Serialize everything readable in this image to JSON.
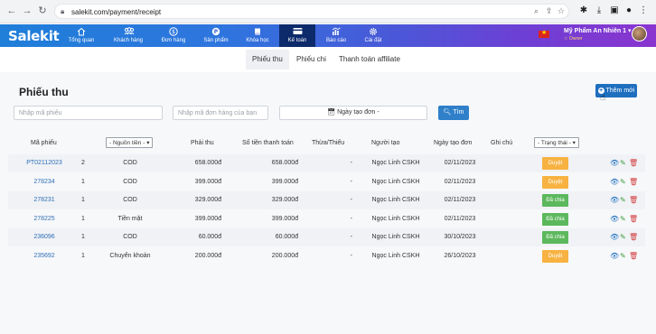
{
  "browser": {
    "url": "salekit.com/payment/receipt"
  },
  "header": {
    "logo": "Salekit",
    "menu": [
      {
        "label": "Tổng quan",
        "icon": "home-icon"
      },
      {
        "label": "Khách hàng",
        "icon": "users-icon"
      },
      {
        "label": "Đơn hàng",
        "icon": "dollar-icon"
      },
      {
        "label": "Sản phẩm",
        "icon": "product-icon"
      },
      {
        "label": "Khóa học",
        "icon": "book-icon"
      },
      {
        "label": "Kế toán",
        "icon": "card-icon"
      },
      {
        "label": "Báo cáo",
        "icon": "chart-icon"
      },
      {
        "label": "Cài đặt",
        "icon": "gear-icon"
      }
    ],
    "active_menu": "Kế toán",
    "user_name": "Mỹ Phẩm An Nhiên 1",
    "user_role": "Owner"
  },
  "subtabs": [
    {
      "label": "Phiếu thu",
      "active": true
    },
    {
      "label": "Phiếu chi",
      "active": false
    },
    {
      "label": "Thanh toán affiliate",
      "active": false
    }
  ],
  "page": {
    "title": "Phiếu thu",
    "add_button": "Thêm mới",
    "filters": {
      "receipt_placeholder": "Nhập mã phiếu",
      "order_placeholder": "Nhập mã đơn hàng của bạn",
      "date_label": "Ngày tạo đơn -",
      "search_label": "Tìm"
    }
  },
  "table": {
    "columns": {
      "code": "Mã phiếu",
      "source": "- Nguồn tiền -",
      "payable": "Phải thu",
      "paid": "Số tiền thanh toán",
      "diff": "Thừa/Thiếu",
      "creator": "Người tạo",
      "created": "Ngày tạo đơn",
      "note": "Ghi chú",
      "status": "- Trạng thái -"
    },
    "rows": [
      {
        "code": "PT02112023",
        "qty": "2",
        "source": "COD",
        "payable": "658.000đ",
        "paid": "658.000đ",
        "diff": "-",
        "creator": "Ngọc Linh CSKH",
        "date": "02/11/2023",
        "status": "Duyệt"
      },
      {
        "code": "278234",
        "qty": "1",
        "source": "COD",
        "payable": "399.000đ",
        "paid": "399.000đ",
        "diff": "-",
        "creator": "Ngọc Linh CSKH",
        "date": "02/11/2023",
        "status": "Duyệt"
      },
      {
        "code": "278231",
        "qty": "1",
        "source": "COD",
        "payable": "329.000đ",
        "paid": "329.000đ",
        "diff": "-",
        "creator": "Ngọc Linh CSKH",
        "date": "02/11/2023",
        "status": "Đã chia"
      },
      {
        "code": "278225",
        "qty": "1",
        "source": "Tiền mặt",
        "payable": "399.000đ",
        "paid": "399.000đ",
        "diff": "-",
        "creator": "Ngọc Linh CSKH",
        "date": "02/11/2023",
        "status": "Đã chia"
      },
      {
        "code": "236096",
        "qty": "1",
        "source": "COD",
        "payable": "60.000đ",
        "paid": "60.000đ",
        "diff": "-",
        "creator": "Ngọc Linh CSKH",
        "date": "30/10/2023",
        "status": "Đã chia"
      },
      {
        "code": "235692",
        "qty": "1",
        "source": "Chuyển khoản",
        "payable": "200.000đ",
        "paid": "200.000đ",
        "diff": "-",
        "creator": "Ngọc Linh CSKH",
        "date": "26/10/2023",
        "status": "Duyệt"
      }
    ]
  },
  "colors": {
    "status_duyet": "#f7b241",
    "status_da_chia": "#5cb85c",
    "link": "#2f6fb5",
    "primary": "#1f6fbf"
  }
}
